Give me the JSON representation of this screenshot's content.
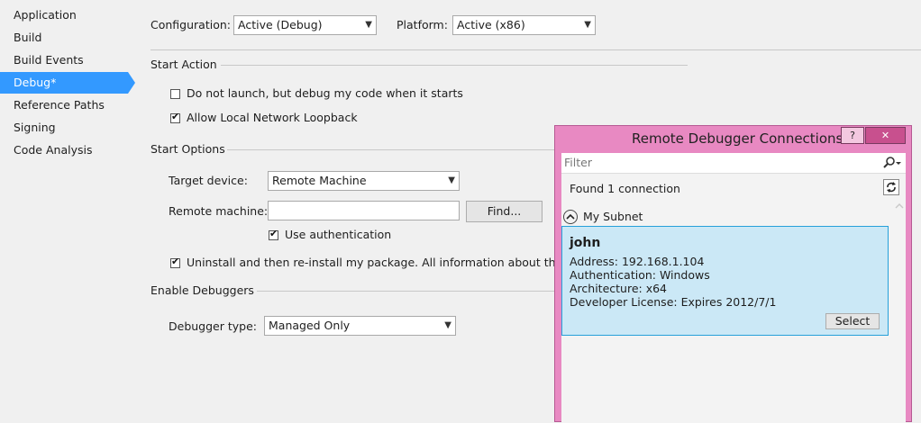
{
  "sidebar": {
    "items": [
      {
        "label": "Application"
      },
      {
        "label": "Build"
      },
      {
        "label": "Build Events"
      },
      {
        "label": "Debug*"
      },
      {
        "label": "Reference Paths"
      },
      {
        "label": "Signing"
      },
      {
        "label": "Code Analysis"
      }
    ],
    "selected": "Debug*"
  },
  "config": {
    "configuration_label": "Configuration:",
    "configuration_value": "Active (Debug)",
    "platform_label": "Platform:",
    "platform_value": "Active (x86)"
  },
  "start_action": {
    "header": "Start Action",
    "do_not_launch_label": "Do not launch, but debug my code when it starts",
    "do_not_launch_checked": false,
    "loopback_label": "Allow Local Network Loopback",
    "loopback_checked": true
  },
  "start_options": {
    "header": "Start Options",
    "target_device_label": "Target device:",
    "target_device_value": "Remote Machine",
    "remote_machine_label": "Remote machine:",
    "remote_machine_value": "",
    "find_button": "Find...",
    "use_auth_label": "Use authentication",
    "use_auth_checked": true,
    "uninstall_label": "Uninstall and then re-install my package. All information about the app",
    "uninstall_checked": true
  },
  "enable_debuggers": {
    "header": "Enable Debuggers",
    "debugger_type_label": "Debugger type:",
    "debugger_type_value": "Managed Only"
  },
  "dialog": {
    "title": "Remote Debugger Connections",
    "help_glyph": "?",
    "close_glyph": "✕",
    "filter_placeholder": "Filter",
    "found_text": "Found 1 connection",
    "group_label": "My Subnet",
    "connection": {
      "name": "john",
      "address": "Address: 192.168.1.104",
      "authentication": "Authentication: Windows",
      "architecture": "Architecture: x64",
      "license": "Developer License: Expires 2012/7/1",
      "select_button": "Select"
    },
    "colors": {
      "titlebar": "#e889c2",
      "card": "#cbe8f6",
      "card_border": "#26a0da"
    }
  },
  "icons": [
    "search-icon",
    "refresh-icon",
    "collapse-icon",
    "dropdown-arrow-icon",
    "checkmark-icon"
  ]
}
